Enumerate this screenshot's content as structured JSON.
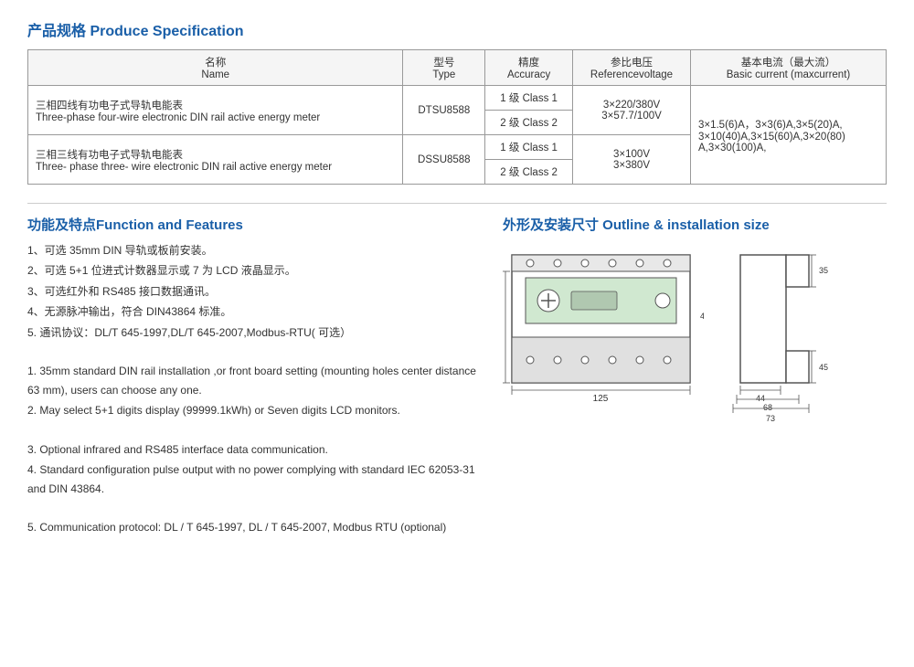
{
  "page": {
    "spec_title": "产品规格 Produce Specification",
    "features_title": "功能及特点Function and Features",
    "outline_title": "外形及安装尺寸 Outline & installation size"
  },
  "table": {
    "headers": {
      "name_zh": "名称",
      "name_en": "Name",
      "type_zh": "型号",
      "type_en": "Type",
      "accuracy_zh": "精度",
      "accuracy_en": "Accuracy",
      "ref_voltage_zh": "参比电压",
      "ref_voltage_en": "Referencevoltage",
      "base_current_zh": "基本电流（最大流）",
      "base_current_en": "Basic current (maxcurrent)"
    },
    "rows": [
      {
        "name_zh": "三相四线有功电子式导轨电能表",
        "name_en": "Three-phase four-wire electronic DIN rail active energy meter",
        "type": "DTSU8588",
        "class1": "1 级 Class 1",
        "class2": "2 级 Class 2",
        "ref_voltage": "3×220/380V\n3×57.7/100V",
        "base_current": "3×1.5(6)A，3×3(6)A,3×5(20)A,\n3×10(40)A,3×15(60)A,3×20(80)\nA,3×30(100)A,"
      },
      {
        "name_zh": "三相三线有功电子式导轨电能表",
        "name_en": "Three- phase three- wire electronic DIN rail active energy meter",
        "type": "DSSU8588",
        "class1": "1 级 Class 1",
        "class2": "2 级 Class 2",
        "ref_voltage": "3×100V\n3×380V",
        "base_current": ""
      }
    ]
  },
  "features": {
    "zh": [
      "1、可选 35mm DIN 导轨或板前安装。",
      "2、可选 5+1 位进式计数器显示或 7 为 LCD 液晶显示。",
      "3、可选红外和 RS485 接口数据通讯。",
      "4、无源脉冲输出，符合 DIN43864 标准。",
      "5. 通讯协议：DL/T 645-1997,DL/T 645-2007,Modbus-RTU( 可选）"
    ],
    "en": [
      "1. 35mm standard DIN rail installation ,or front board setting (mounting holes center distance 63 mm), users can choose any one.",
      "2. May select 5+1 digits display (99999.1kWh) or Seven digits LCD monitors.",
      "3. Optional infrared and RS485 interface data communication.",
      "4. Standard configuration pulse output with no power complying with standard IEC 62053-31 and DIN 43864.",
      "5. Communication protocol: DL / T 645-1997, DL / T 645-2007, Modbus RTU (optional)"
    ]
  }
}
